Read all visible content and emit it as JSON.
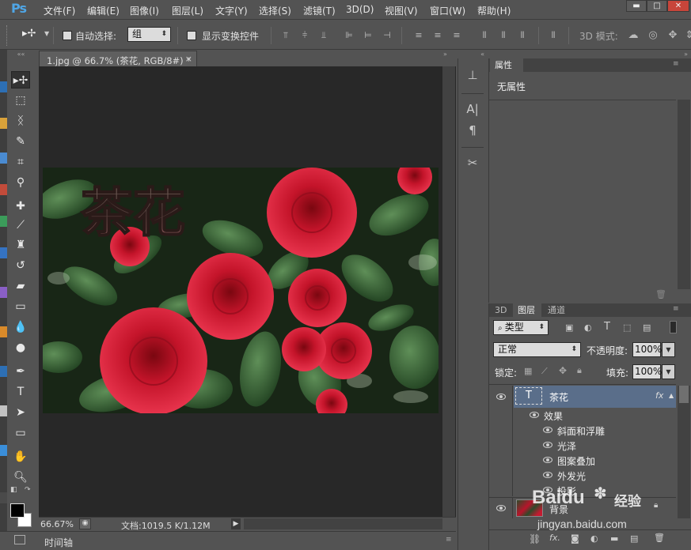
{
  "app": {
    "logo": "Ps"
  },
  "menu": [
    "文件(F)",
    "编辑(E)",
    "图像(I)",
    "图层(L)",
    "文字(Y)",
    "选择(S)",
    "滤镜(T)",
    "3D(D)",
    "视图(V)",
    "窗口(W)",
    "帮助(H)"
  ],
  "window_controls": {
    "minimize": "▬",
    "maximize": "□",
    "close": "✕"
  },
  "options": {
    "auto_select_label": "自动选择:",
    "auto_select_value": "组",
    "show_transform_label": "显示变换控件",
    "mode_3d_label": "3D 模式:"
  },
  "document": {
    "tab_title": "1.jpg @ 66.7% (茶花, RGB/8#) *",
    "tab_close": "×",
    "canvas_text": "茶花",
    "zoom": "66.67%",
    "doc_info": "文档:1019.5 K/1.12M"
  },
  "timeline_label": "时间轴",
  "properties": {
    "tab": "属性",
    "empty_text": "无属性"
  },
  "layers_panel": {
    "tabs": [
      "3D",
      "图层",
      "通道"
    ],
    "filter_kind": "类型",
    "blend_mode": "正常",
    "opacity_label": "不透明度:",
    "opacity_value": "100%",
    "lock_label": "锁定:",
    "fill_label": "填充:",
    "fill_value": "100%",
    "text_layer_name": "茶花",
    "effects_label": "效果",
    "effects": [
      "斜面和浮雕",
      "光泽",
      "图案叠加",
      "外发光",
      "投影"
    ],
    "bg_layer_name": "背景",
    "fx_label": "fx"
  },
  "watermark": {
    "brand": "Baidu",
    "brand_cn": "经验",
    "url": "jingyan.baidu.com"
  },
  "colors": {
    "accent": "#4fa6e6",
    "selected_layer": "#5a6e8a",
    "panel": "#535353",
    "canvas_bg": "#282828"
  }
}
